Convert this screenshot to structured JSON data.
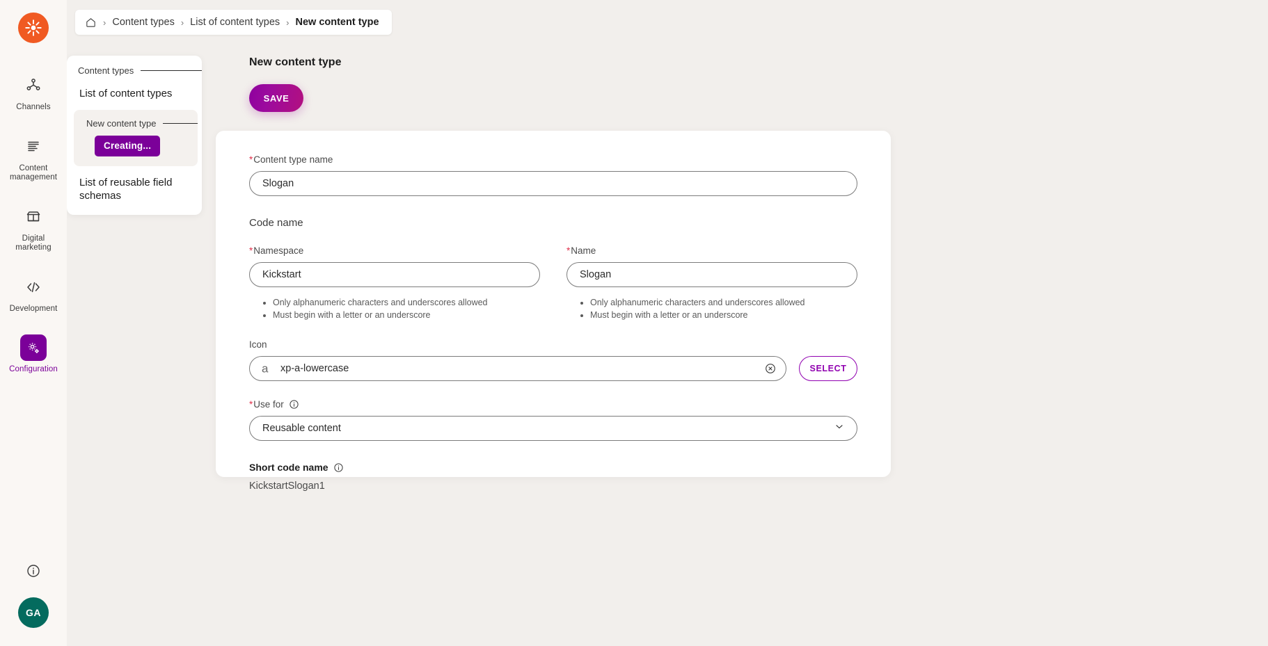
{
  "colors": {
    "brand_orange": "#f05a22",
    "accent_purple": "#7b0099",
    "select_purple": "#9000b0",
    "avatar_teal": "#046b5e",
    "required_red": "#e0314b",
    "page_bg": "#f2efec",
    "rail_bg": "#faf7f4"
  },
  "rail": {
    "logo_name": "kentico-logo-icon",
    "items": [
      {
        "label": "Channels",
        "icon": "channels-icon",
        "active": false
      },
      {
        "label": "Content management",
        "icon": "content-management-icon",
        "active": false
      },
      {
        "label": "Digital marketing",
        "icon": "digital-marketing-icon",
        "active": false
      },
      {
        "label": "Development",
        "icon": "development-icon",
        "active": false
      },
      {
        "label": "Configuration",
        "icon": "configuration-icon",
        "active": true
      }
    ],
    "info_icon": "info-circle-icon",
    "avatar_initials": "GA"
  },
  "breadcrumb": {
    "home_icon": "home-icon",
    "separator": "›",
    "items": [
      {
        "label": "Content types",
        "current": false
      },
      {
        "label": "List of content types",
        "current": false
      },
      {
        "label": "New content type",
        "current": true
      }
    ]
  },
  "nav_card": {
    "header": "Content types",
    "level1": "List of content types",
    "sub_header": "New content type",
    "status_badge": "Creating...",
    "level1_last": "List of reusable field schemas"
  },
  "main": {
    "page_title": "New content type",
    "save_label": "SAVE"
  },
  "form": {
    "content_type_name": {
      "label": "Content type name",
      "required": true,
      "value": "Slogan",
      "placeholder": "Content type name"
    },
    "code_name_section": "Code name",
    "namespace": {
      "label": "Namespace",
      "required": true,
      "value": "Kickstart",
      "placeholder": "Namespace",
      "hints": [
        "Only alphanumeric characters and underscores allowed",
        "Must begin with a letter or an underscore"
      ]
    },
    "name": {
      "label": "Name",
      "required": true,
      "value": "Slogan",
      "placeholder": "Name",
      "hints": [
        "Only alphanumeric characters and underscores allowed",
        "Must begin with a letter or an underscore"
      ]
    },
    "icon": {
      "label": "Icon",
      "required": false,
      "glyph": "a",
      "value": "xp-a-lowercase",
      "placeholder": "Icon",
      "clear_icon": "clear-circle-icon",
      "select_label": "SELECT"
    },
    "use_for": {
      "label": "Use for",
      "required": true,
      "info_icon": "info-icon",
      "value": "Reusable content",
      "chevron_icon": "chevron-down-icon",
      "options": [
        "Reusable content"
      ]
    },
    "short_code_name": {
      "label": "Short code name",
      "info_icon": "info-icon",
      "value": "KickstartSlogan1"
    }
  }
}
